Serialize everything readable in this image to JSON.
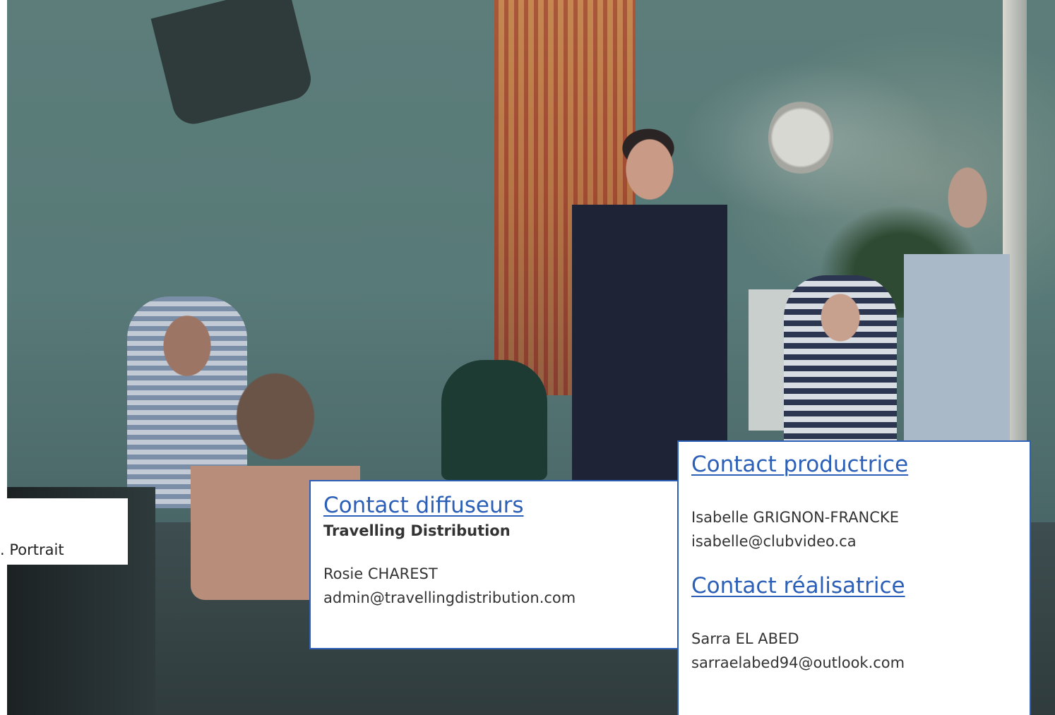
{
  "caption": {
    "text": ". Portrait"
  },
  "diffuseurs": {
    "heading": "Contact diffuseurs",
    "company": "Travelling Distribution",
    "name": "Rosie CHAREST",
    "email": "admin@travellingdistribution.com"
  },
  "productrice": {
    "heading": "Contact productrice",
    "name": "Isabelle GRIGNON-FRANCKE",
    "email": "isabelle@clubvideo.ca"
  },
  "realisatrice": {
    "heading": "Contact réalisatrice",
    "name": "Sarra EL ABED",
    "email": "sarraelabed94@outlook.com"
  },
  "colors": {
    "link": "#2b5fb8",
    "text": "#333333",
    "card_border": "#2b5fb8",
    "background": "#ffffff"
  }
}
